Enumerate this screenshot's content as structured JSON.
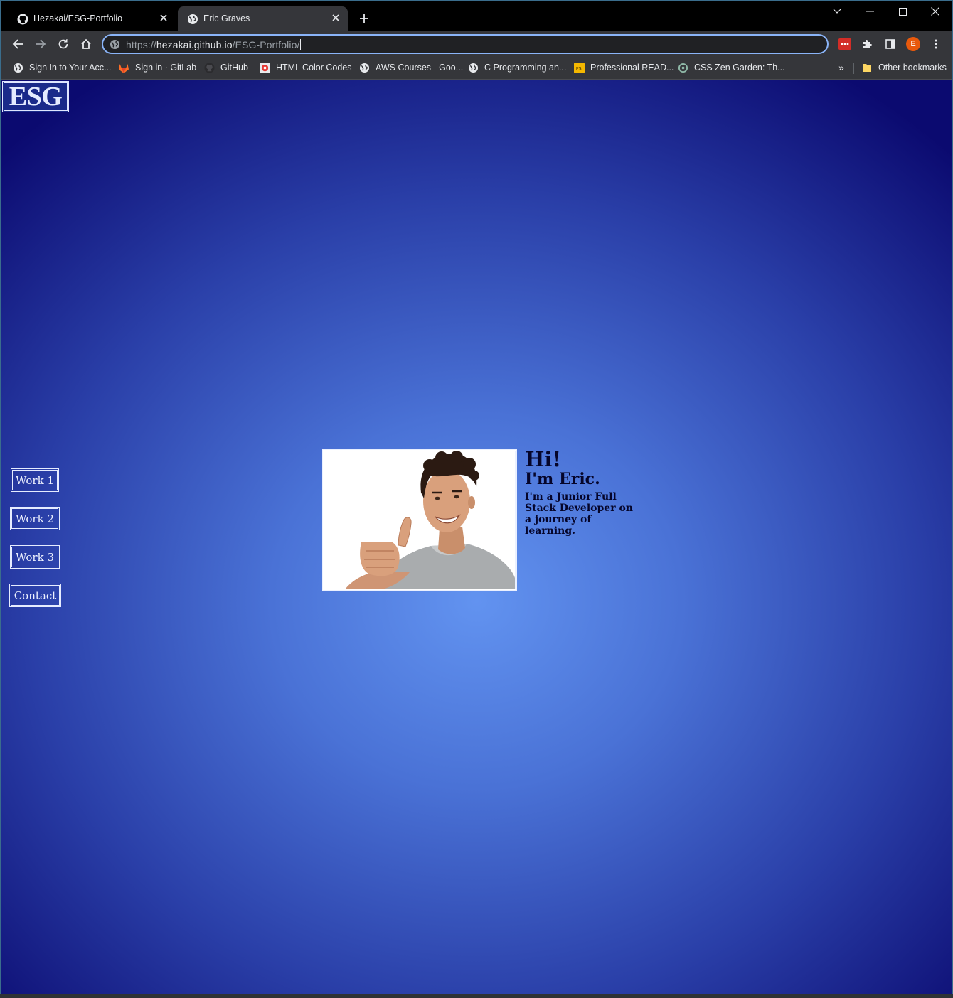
{
  "browser": {
    "tabs": [
      {
        "title": "Hezakai/ESG-Portfolio",
        "icon": "github-icon",
        "active": false
      },
      {
        "title": "Eric Graves",
        "icon": "globe-icon",
        "active": true
      }
    ],
    "new_tab_label": "+",
    "window_controls": [
      "chevron-down-icon",
      "minimize-icon",
      "maximize-icon",
      "close-icon"
    ],
    "address": {
      "scheme": "https://",
      "host": "hezakai.github.io",
      "path": "/ESG-Portfolio/"
    },
    "profile_initial": "E",
    "bookmarks": [
      {
        "label": "Sign In to Your Acc...",
        "icon": "globe-icon"
      },
      {
        "label": "Sign in · GitLab",
        "icon": "gitlab-icon"
      },
      {
        "label": "GitHub",
        "icon": "github-icon"
      },
      {
        "label": "HTML Color Codes",
        "icon": "color-codes-icon"
      },
      {
        "label": "AWS Courses - Goo...",
        "icon": "globe-icon"
      },
      {
        "label": "C Programming an...",
        "icon": "globe-icon"
      },
      {
        "label": "Professional READ...",
        "icon": "readme-icon"
      },
      {
        "label": "CSS Zen Garden: Th...",
        "icon": "zen-garden-icon"
      }
    ],
    "bookmarks_overflow": "»",
    "other_bookmarks": "Other bookmarks"
  },
  "site": {
    "logo": "ESG",
    "nav": [
      {
        "label": "Work 1"
      },
      {
        "label": "Work 2"
      },
      {
        "label": "Work 3"
      },
      {
        "label": "Contact"
      }
    ],
    "hero": {
      "greeting": "Hi!",
      "name": "I'm Eric.",
      "bio": "I'm a Junior Full Stack Developer on a journey of learning."
    }
  },
  "colors": {
    "browser_frame": "#000000",
    "toolbar": "#35363a",
    "omnibox_focus": "#8ab4f8",
    "page_center": "#6293f0",
    "page_edge": "#0b0a70",
    "hero_text": "#05052a",
    "link_text": "#eef2ff"
  }
}
